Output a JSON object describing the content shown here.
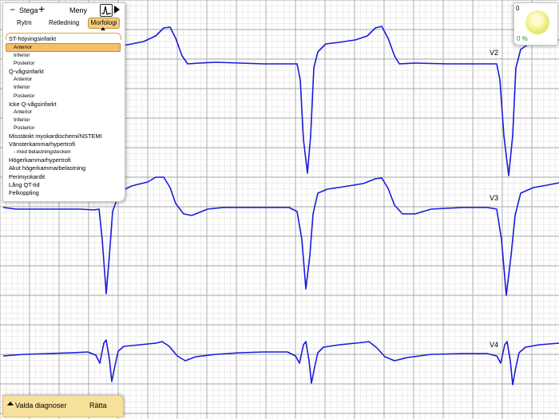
{
  "topbar": {
    "step_minus": "−",
    "step_label": "Stega",
    "step_plus": "+",
    "menu_label": "Meny"
  },
  "tabs": [
    {
      "label": "Rytm"
    },
    {
      "label": "Retledning"
    },
    {
      "label": "Morfologi"
    }
  ],
  "menu_items": [
    {
      "label": "ST-höjningsinfarkt",
      "level": 0
    },
    {
      "label": "Anterior",
      "level": 1,
      "selected": true
    },
    {
      "label": "Inferior",
      "level": 1
    },
    {
      "label": "Posterior",
      "level": 1
    },
    {
      "label": "Q-vågsinfarkt",
      "level": 0
    },
    {
      "label": "Anterior",
      "level": 1
    },
    {
      "label": "Inferior",
      "level": 1
    },
    {
      "label": "Posterior",
      "level": 1
    },
    {
      "label": "Icke Q-vågsinfarkt",
      "level": 0
    },
    {
      "label": "Anterior",
      "level": 1
    },
    {
      "label": "Inferior",
      "level": 1
    },
    {
      "label": "Posterior",
      "level": 1
    },
    {
      "label": "Misstänkt myokardischemi/NSTEMI",
      "level": 0
    },
    {
      "label": "Vänsterkammarhypertrofi",
      "level": 0
    },
    {
      "label": "- med belastningstecken",
      "level": 1
    },
    {
      "label": "Högerkammarhypertrofi",
      "level": 0
    },
    {
      "label": "Akut högerkammarbelastning",
      "level": 0
    },
    {
      "label": "Perimyokardit",
      "level": 0
    },
    {
      "label": "Lång QT-tid",
      "level": 0
    },
    {
      "label": "Felkoppling",
      "level": 0
    }
  ],
  "gauge": {
    "count": "0",
    "percent": "0 %"
  },
  "bottombar": {
    "selected_label": "Valda diagnoser",
    "correct_label": "Rätta"
  },
  "leads": [
    {
      "label": "V2"
    },
    {
      "label": "V3"
    },
    {
      "label": "V4"
    }
  ],
  "colors": {
    "trace": "#1a1adc",
    "grid_major": "#a6a6a6",
    "grid_minor": "#e2e2e2",
    "accent": "#f4bf6c",
    "bottom_bar": "#f7e19a"
  }
}
